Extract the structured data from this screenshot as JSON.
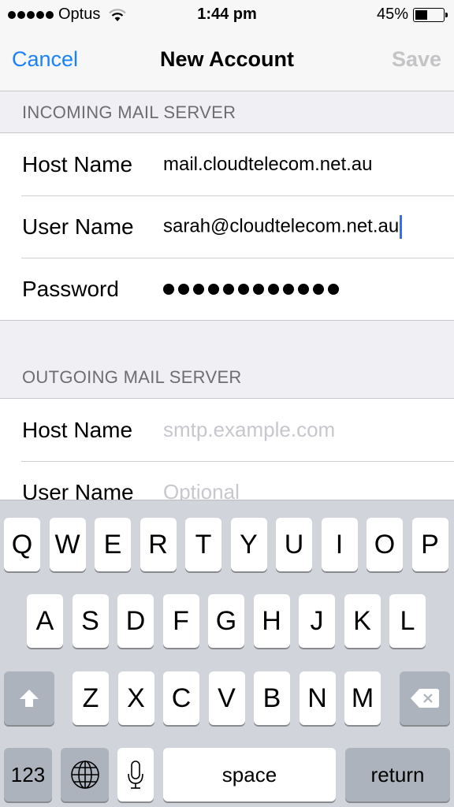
{
  "status_bar": {
    "signal_bars": 5,
    "carrier": "Optus",
    "wifi_icon": "wifi-icon",
    "time": "1:44 pm",
    "battery_percent_label": "45%",
    "battery_level": 0.45
  },
  "nav": {
    "cancel_label": "Cancel",
    "title": "New Account",
    "save_label": "Save"
  },
  "incoming": {
    "header": "INCOMING MAIL SERVER",
    "rows": [
      {
        "label": "Host Name",
        "value": "mail.cloudtelecom.net.au"
      },
      {
        "label": "User Name",
        "value": "sarah@cloudtelecom.net.au"
      },
      {
        "label": "Password",
        "value_masked_length": 12
      }
    ]
  },
  "outgoing": {
    "header": "OUTGOING MAIL SERVER",
    "rows": [
      {
        "label": "Host Name",
        "placeholder": "smtp.example.com"
      },
      {
        "label": "User Name",
        "placeholder": "Optional"
      }
    ]
  },
  "keyboard": {
    "row1": [
      "Q",
      "W",
      "E",
      "R",
      "T",
      "Y",
      "U",
      "I",
      "O",
      "P"
    ],
    "row2": [
      "A",
      "S",
      "D",
      "F",
      "G",
      "H",
      "J",
      "K",
      "L"
    ],
    "row3": [
      "Z",
      "X",
      "C",
      "V",
      "B",
      "N",
      "M"
    ],
    "numbers_label": "123",
    "space_label": "space",
    "return_label": "return",
    "icons": {
      "shift": "shift-arrow-icon",
      "delete": "delete-backspace-icon",
      "globe": "globe-icon",
      "mic": "microphone-icon"
    }
  },
  "colors": {
    "accent": "#1a82fb",
    "disabled": "#c4c4c6",
    "section_bg": "#efeff4",
    "keyboard_bg": "#d1d5db",
    "caret": "#3a6cf4"
  }
}
